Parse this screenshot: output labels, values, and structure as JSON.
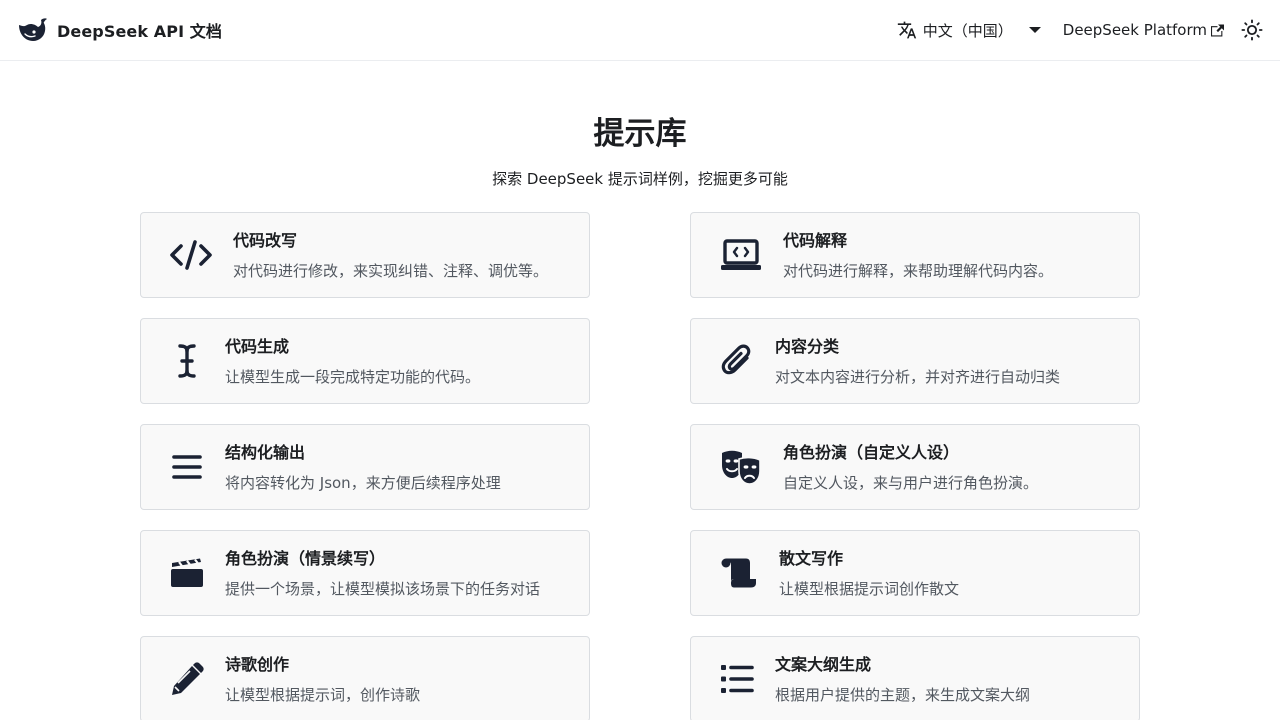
{
  "navbar": {
    "brand_title": "DeepSeek API 文档",
    "language_label": "中文（中国）",
    "platform_label": "DeepSeek Platform",
    "icons": [
      "deepseek-logo-icon",
      "translate-icon",
      "caret-down-icon",
      "external-link-icon",
      "sun-icon"
    ]
  },
  "hero": {
    "title": "提示库",
    "subtitle": "探索 DeepSeek 提示词样例，挖掘更多可能"
  },
  "cards": [
    {
      "title": "代码改写",
      "desc": "对代码进行修改，来实现纠错、注释、调优等。",
      "icon": "code-icon"
    },
    {
      "title": "代码解释",
      "desc": "对代码进行解释，来帮助理解代码内容。",
      "icon": "laptop-code-icon"
    },
    {
      "title": "代码生成",
      "desc": "让模型生成一段完成特定功能的代码。",
      "icon": "text-cursor-icon"
    },
    {
      "title": "内容分类",
      "desc": "对文本内容进行分析，并对齐进行自动归类",
      "icon": "paperclip-icon"
    },
    {
      "title": "结构化输出",
      "desc": "将内容转化为 Json，来方便后续程序处理",
      "icon": "bars-icon"
    },
    {
      "title": "角色扮演（自定义人设）",
      "desc": "自定义人设，来与用户进行角色扮演。",
      "icon": "masks-theater-icon"
    },
    {
      "title": "角色扮演（情景续写）",
      "desc": "提供一个场景，让模型模拟该场景下的任务对话",
      "icon": "clapperboard-icon"
    },
    {
      "title": "散文写作",
      "desc": "让模型根据提示词创作散文",
      "icon": "scroll-icon"
    },
    {
      "title": "诗歌创作",
      "desc": "让模型根据提示词，创作诗歌",
      "icon": "pencil-icon"
    },
    {
      "title": "文案大纲生成",
      "desc": "根据用户提供的主题，来生成文案大纲",
      "icon": "list-icon"
    }
  ],
  "colors": {
    "text": "#1c1e21",
    "muted": "#525860",
    "card_bg": "#f9f9f9",
    "card_border": "#dadde1",
    "icon": "#1b2233"
  }
}
